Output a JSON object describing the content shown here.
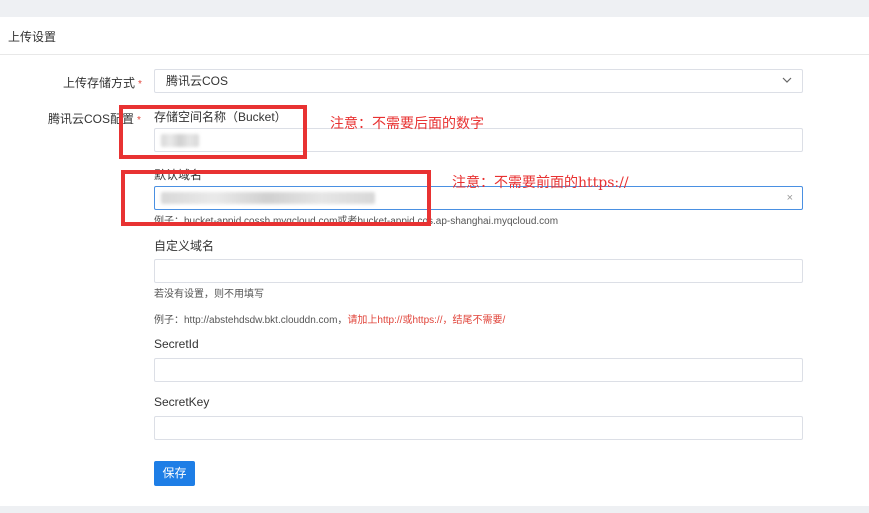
{
  "panel": {
    "title": "上传设置"
  },
  "storage_method": {
    "label": "上传存储方式",
    "required_mark": "*",
    "selected": "腾讯云COS"
  },
  "cos_config": {
    "label": "腾讯云COS配置",
    "required_mark": "*",
    "bucket": {
      "label": "存储空间名称（Bucket）",
      "value": ""
    },
    "domain": {
      "label": "默认域名",
      "value": "",
      "hint": "例子：bucket-appid.cossh.myqcloud.com或者bucket-appid.cos.ap-shanghai.myqcloud.com",
      "clear_glyph": "×"
    },
    "custom_domain": {
      "label": "自定义域名",
      "value": "",
      "hint1": "若没有设置，则不用填写",
      "hint2_prefix": "例子：http://abstehdsdw.bkt.clouddn.com，",
      "hint2_red": "请加上http://或https://，结尾不需要/"
    },
    "secret_id": {
      "label": "SecretId",
      "value": ""
    },
    "secret_key": {
      "label": "SecretKey",
      "value": ""
    }
  },
  "save_label": "保存",
  "annotations": {
    "bucket_note": "注意：不需要后面的数字",
    "domain_note": "注意：不需要前面的https://",
    "color": "#e83232"
  },
  "colors": {
    "primary": "#1e7ee6",
    "required": "#e0443a"
  }
}
